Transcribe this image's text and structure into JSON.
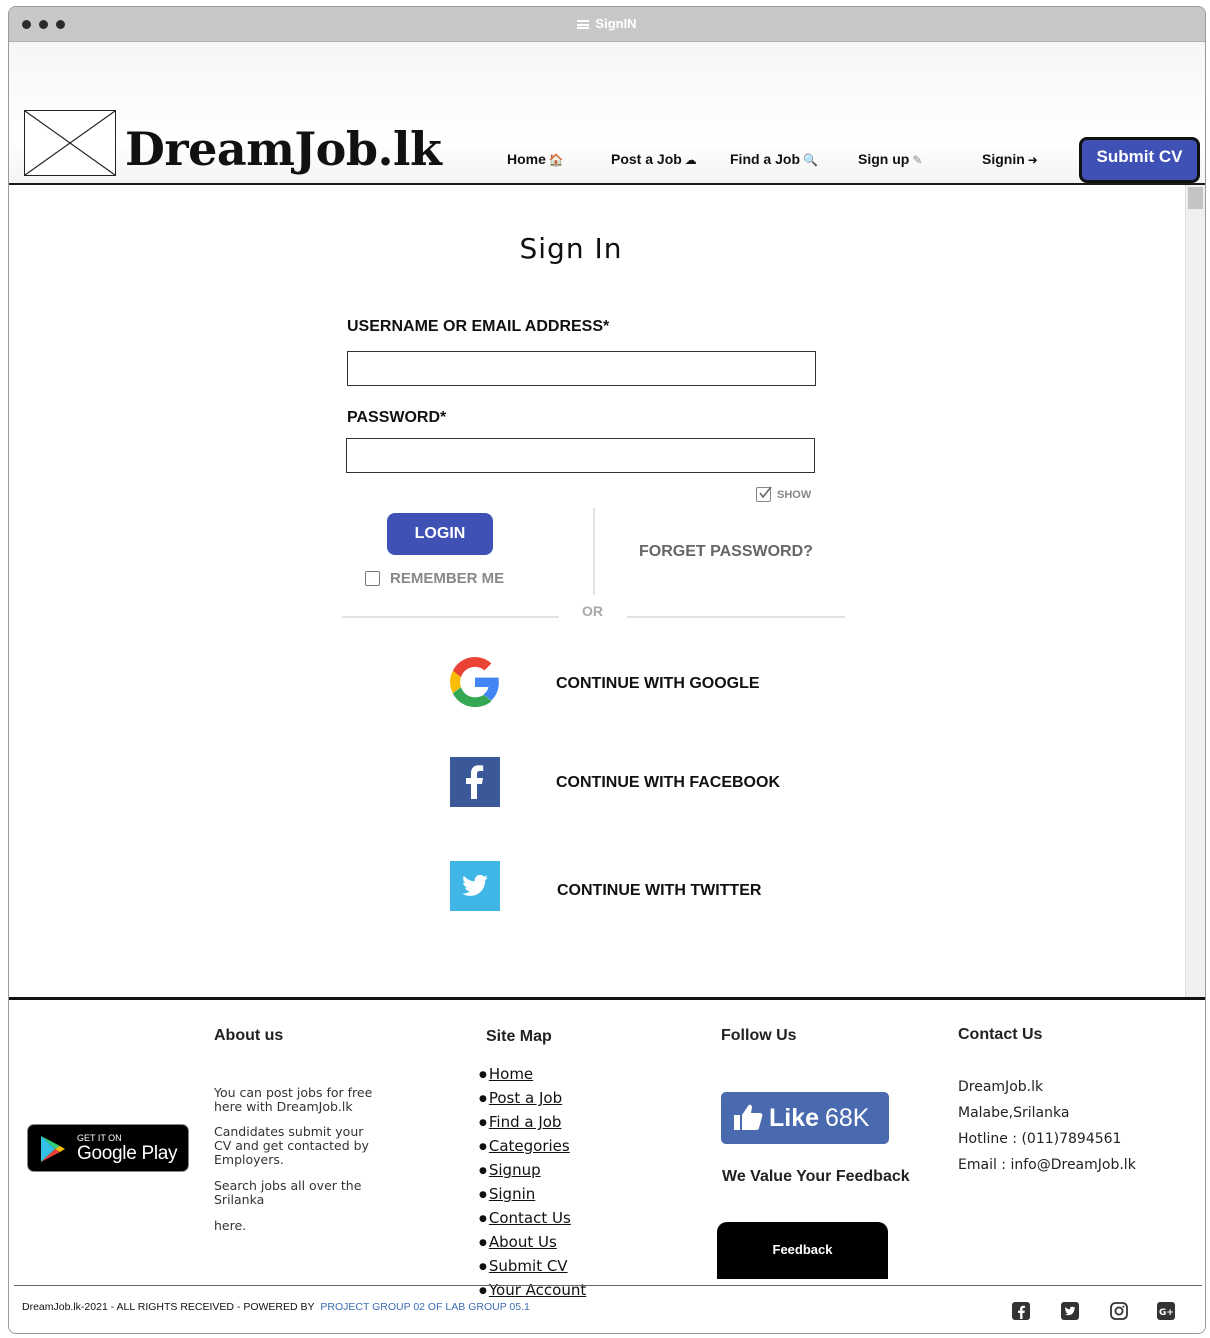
{
  "window": {
    "title": "SignIN"
  },
  "header": {
    "brand": "DreamJob.lk",
    "nav": [
      {
        "label": "Home",
        "icon": "home-icon",
        "glyph": "🏠"
      },
      {
        "label": "Post a Job",
        "icon": "cloud-upload-icon",
        "glyph": "☁"
      },
      {
        "label": "Find a Job",
        "icon": "search-icon",
        "glyph": "🔍"
      },
      {
        "label": "Sign up",
        "icon": "edit-icon",
        "glyph": "✎"
      },
      {
        "label": "Signin",
        "icon": "sign-in-icon",
        "glyph": "➜"
      }
    ],
    "submit_cv": "Submit CV"
  },
  "signin": {
    "title": "Sign In",
    "username_label": "USERNAME OR EMAIL ADDRESS*",
    "username_value": "",
    "password_label": "PASSWORD*",
    "password_value": "",
    "show_label": "SHOW",
    "login_label": "LOGIN",
    "remember_label": "REMEMBER ME",
    "forget_label": "FORGET PASSWORD?",
    "or_label": "OR",
    "google_label": "CONTINUE WITH GOOGLE",
    "facebook_label": "CONTINUE WITH FACEBOOK",
    "twitter_label": "CONTINUE WITH TWITTER"
  },
  "footer": {
    "google_play": {
      "get_it_on": "GET IT ON",
      "store": "Google Play"
    },
    "about": {
      "heading": "About us",
      "p1": "You can post jobs for free here with DreamJob.lk",
      "p2": "Candidates submit your CV and get contacted by Employers.",
      "p3": "Search jobs all over the Srilanka",
      "p4": "here."
    },
    "sitemap": {
      "heading": "Site Map",
      "links": [
        "Home",
        "Post a Job",
        "Find a Job",
        "Categories",
        "Signup",
        "Signin",
        "Contact Us",
        "About Us",
        "Submit CV",
        "Your Account"
      ]
    },
    "follow": {
      "heading": "Follow Us",
      "like_label": "Like",
      "like_count": "68K",
      "feedback_heading": "We Value Your Feedback",
      "feedback_button": "Feedback"
    },
    "contact": {
      "heading": "Contact Us",
      "name": "DreamJob.lk",
      "location": "Malabe,Srilanka",
      "hotline": "Hotline : (011)7894561",
      "email": "Email  : info@DreamJob.lk"
    },
    "copyright": "DreamJob.lk-2021 - ALL RIGHTS RECEIVED - POWERED BY",
    "powered_by": "PROJECT GROUP 02 OF LAB GROUP 05.1",
    "social_icons": [
      "facebook-icon",
      "twitter-icon",
      "instagram-icon",
      "google-plus-icon"
    ]
  },
  "colors": {
    "primary": "#3f51b5",
    "facebook": "#3b5998",
    "twitter": "#40b6e6",
    "link": "#3b6fb3"
  }
}
